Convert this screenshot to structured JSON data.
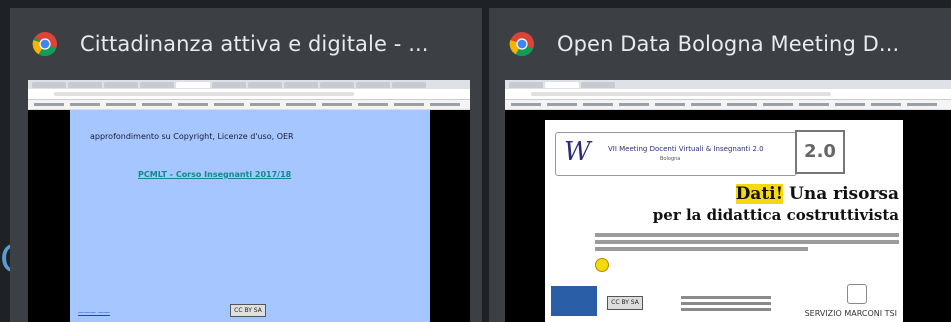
{
  "windows": [
    {
      "title": "Cittadinanza attiva e digitale - ...",
      "icon": "chrome-icon",
      "slide": {
        "line": "approfondimento su Copyright, Licenze d'uso, OER",
        "link": "PCMLT - Corso Insegnanti 2017/18",
        "cc": "CC BY SA"
      }
    },
    {
      "title": "Open Data Bologna Meeting D...",
      "icon": "chrome-icon",
      "slide": {
        "logo_title": "VII Meeting Docenti Virtuali & Insegnanti 2.0",
        "logo_sub": "Bologna",
        "badge": "2.0",
        "heading_highlight": "Dati!",
        "heading_rest": " Una risorsa",
        "subheading": "per la didattica costruttivista",
        "cc": "CC BY SA",
        "school": "SERVIZIO MARCONI TSI"
      }
    }
  ],
  "colors": {
    "background": "#202124",
    "card": "#3c3f43",
    "title_text": "#e8eaed",
    "slide1_bg": "#a5c6ff",
    "highlight": "#f5d90a"
  }
}
